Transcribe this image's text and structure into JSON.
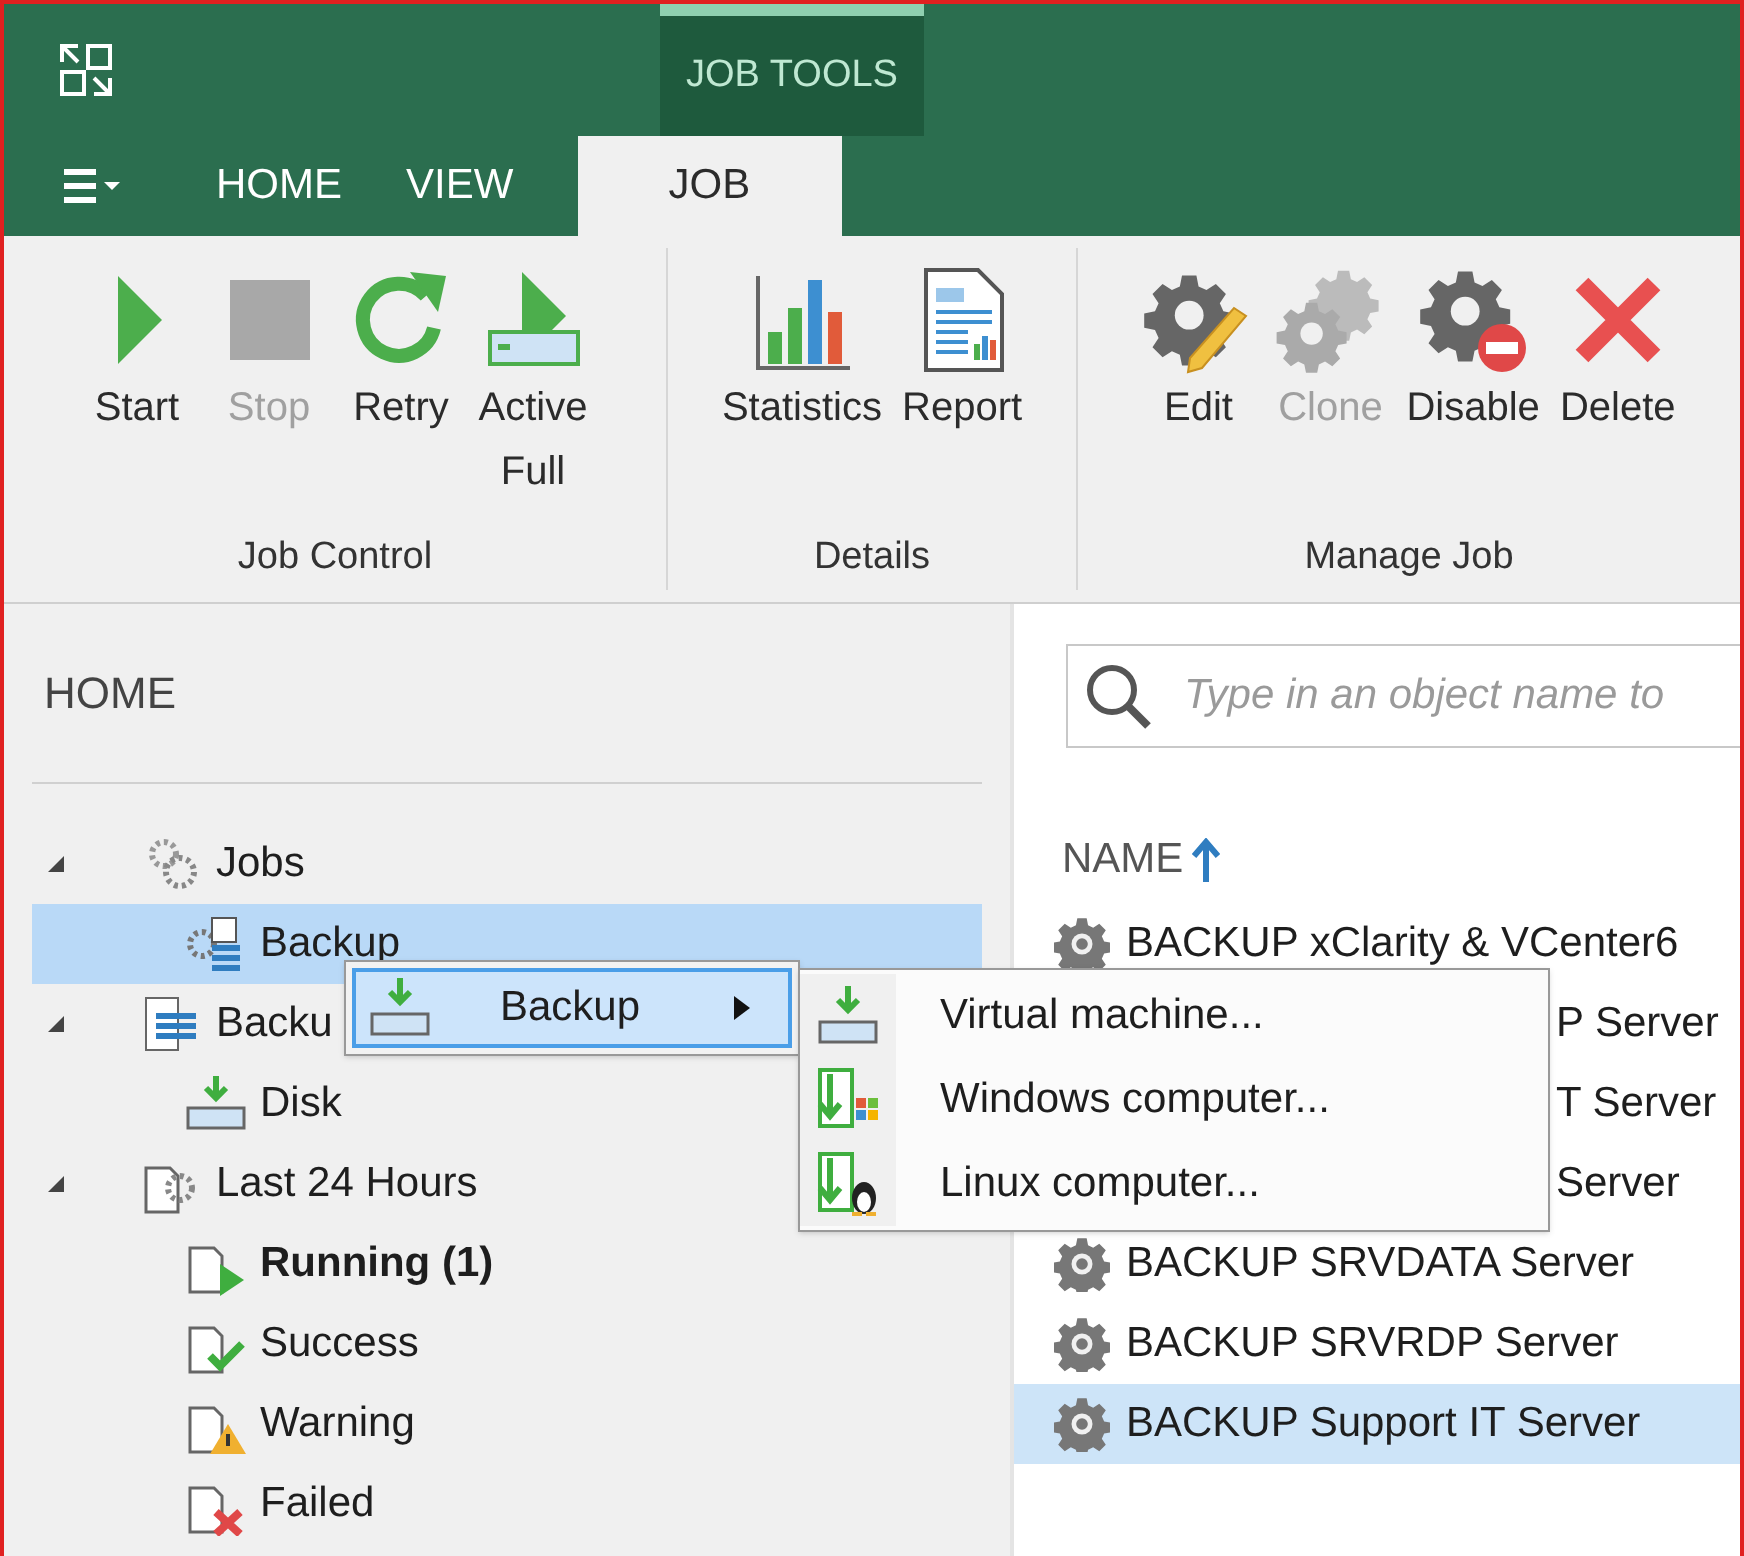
{
  "window": {
    "contextual_tab": "JOB TOOLS"
  },
  "tabs": [
    {
      "label": "HOME",
      "selected": false
    },
    {
      "label": "VIEW",
      "selected": false
    },
    {
      "label": "JOB",
      "selected": true
    }
  ],
  "ribbon": {
    "groups": [
      {
        "label": "Job Control",
        "buttons": [
          {
            "kind": "start",
            "label": "Start",
            "disabled": false
          },
          {
            "kind": "stop",
            "label": "Stop",
            "disabled": true
          },
          {
            "kind": "retry",
            "label": "Retry",
            "disabled": false
          },
          {
            "kind": "active_full",
            "label": "Active Full",
            "disabled": false
          }
        ]
      },
      {
        "label": "Details",
        "buttons": [
          {
            "kind": "statistics",
            "label": "Statistics",
            "disabled": false
          },
          {
            "kind": "report",
            "label": "Report",
            "disabled": false
          }
        ]
      },
      {
        "label": "Manage Job",
        "buttons": [
          {
            "kind": "edit",
            "label": "Edit",
            "disabled": false
          },
          {
            "kind": "clone",
            "label": "Clone",
            "disabled": true
          },
          {
            "kind": "disable",
            "label": "Disable",
            "disabled": false
          },
          {
            "kind": "delete",
            "label": "Delete",
            "disabled": false
          }
        ]
      }
    ]
  },
  "sidebar": {
    "title": "HOME",
    "tree": [
      {
        "kind": "jobs",
        "label": "Jobs",
        "expanded": true,
        "selected": false,
        "bold": false,
        "children": [
          {
            "kind": "backup_job",
            "label": "Backup",
            "selected": true,
            "bold": false
          }
        ]
      },
      {
        "kind": "backups",
        "label": "Backu",
        "expanded": true,
        "selected": false,
        "bold": false,
        "children": [
          {
            "kind": "disk",
            "label": "Disk",
            "selected": false,
            "bold": false
          }
        ]
      },
      {
        "kind": "last24",
        "label": "Last 24 Hours",
        "expanded": true,
        "selected": false,
        "bold": false,
        "children": [
          {
            "kind": "running",
            "label": "Running (1)",
            "selected": false,
            "bold": true
          },
          {
            "kind": "success",
            "label": "Success",
            "selected": false,
            "bold": false
          },
          {
            "kind": "warning",
            "label": "Warning",
            "selected": false,
            "bold": false
          },
          {
            "kind": "failed",
            "label": "Failed",
            "selected": false,
            "bold": false
          }
        ]
      }
    ]
  },
  "search": {
    "placeholder": "Type in an object name to"
  },
  "table": {
    "columns": [
      "NAME"
    ],
    "rows": [
      {
        "kind": "full",
        "name": "BACKUP xClarity & VCenter6",
        "selected": false
      },
      {
        "kind": "partial",
        "name": "P Server",
        "selected": false
      },
      {
        "kind": "partial",
        "name": "T Server",
        "selected": false
      },
      {
        "kind": "partial",
        "name": "Server",
        "selected": false
      },
      {
        "kind": "full",
        "name": "BACKUP SRVDATA Server",
        "selected": false
      },
      {
        "kind": "full",
        "name": "BACKUP SRVRDP Server",
        "selected": false
      },
      {
        "kind": "full",
        "name": "BACKUP Support IT Server",
        "selected": true
      }
    ]
  },
  "context_menu": {
    "items": [
      {
        "label": "Backup",
        "selected": true,
        "has_submenu": true
      }
    ]
  },
  "submenu": {
    "items": [
      {
        "kind": "vm",
        "label": "Virtual machine...",
        "selected": false
      },
      {
        "kind": "windows",
        "label": "Windows computer...",
        "selected": false
      },
      {
        "kind": "linux",
        "label": "Linux computer...",
        "selected": false
      }
    ]
  }
}
